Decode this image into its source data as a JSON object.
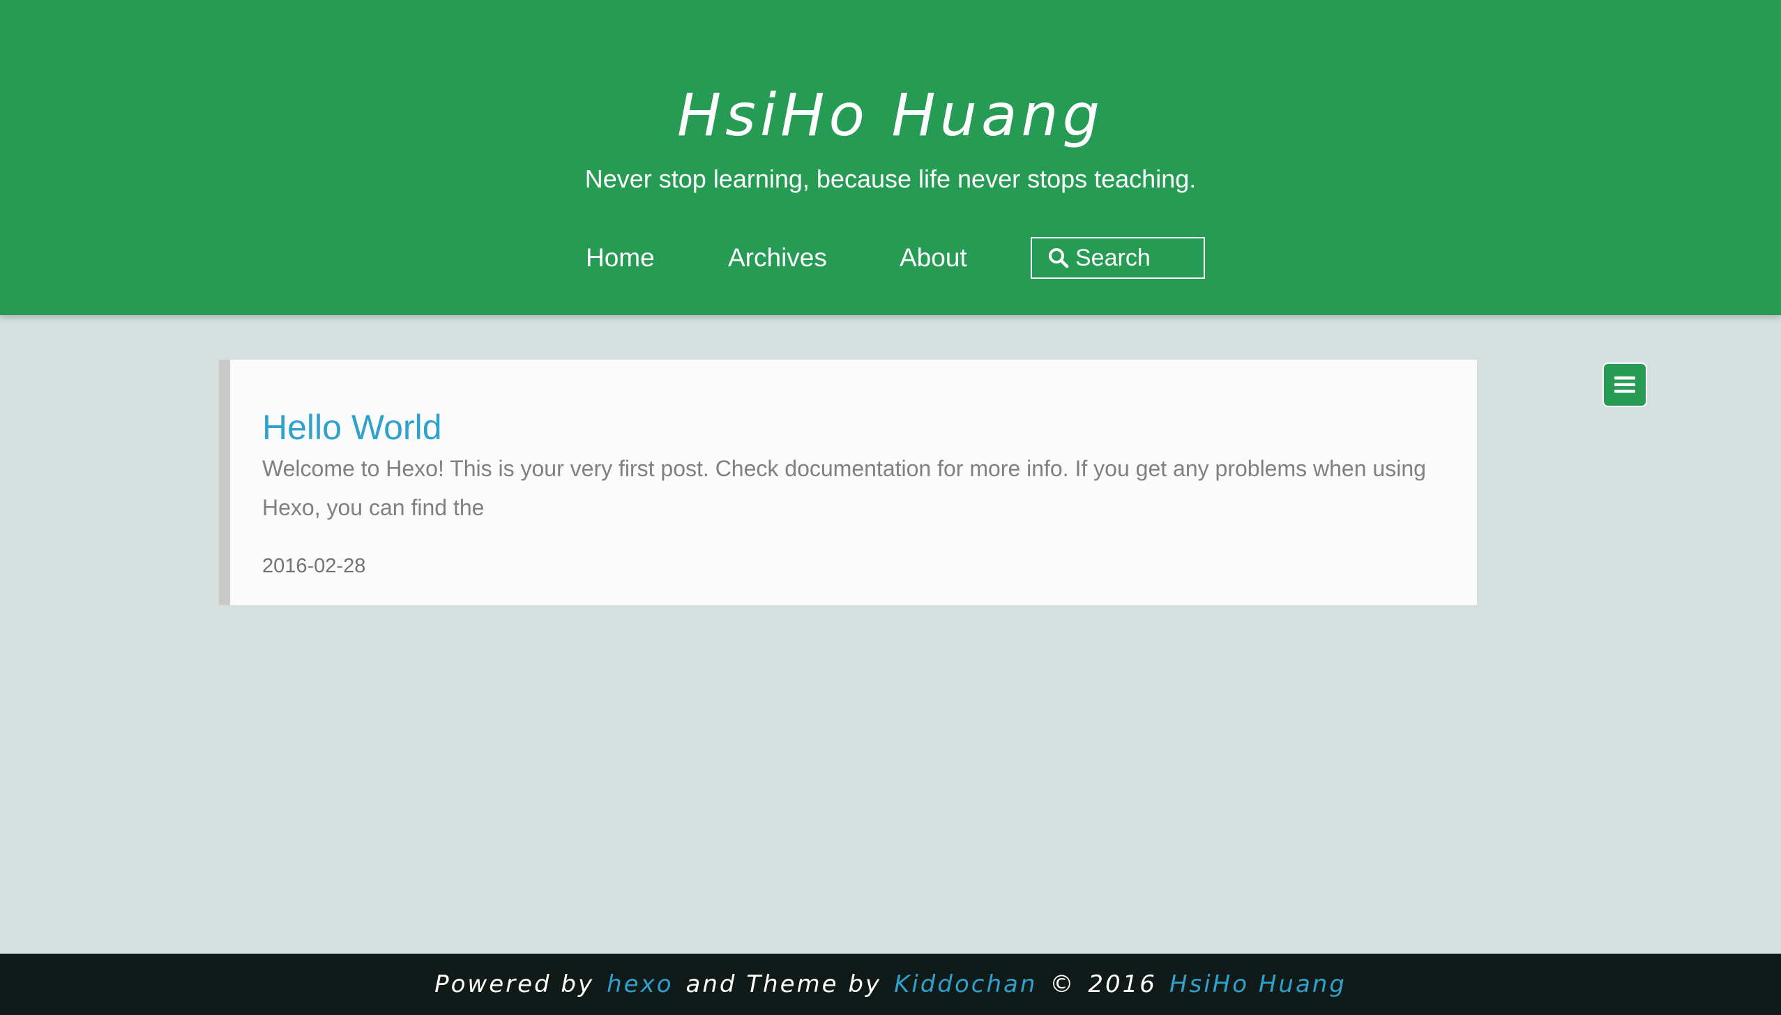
{
  "header": {
    "title": "HsiHo Huang",
    "subtitle": "Never stop learning, because life never stops teaching."
  },
  "nav": {
    "items": [
      {
        "label": "Home"
      },
      {
        "label": "Archives"
      },
      {
        "label": "About"
      }
    ],
    "search": {
      "label": "Search",
      "icon": "search-icon"
    }
  },
  "post": {
    "title": "Hello World",
    "excerpt": "Welcome to Hexo! This is your very first post. Check documentation for more info. If you get any problems when using Hexo, you can find the",
    "date": "2016-02-28"
  },
  "menu_toggle": {
    "icon": "hamburger-menu-icon"
  },
  "footer": {
    "powered_by": "Powered by",
    "hexo": "hexo",
    "and_theme_by": "and Theme by",
    "theme_author": "Kiddochan",
    "copyright": "©",
    "year": "2016",
    "owner": "HsiHo Huang"
  },
  "colors": {
    "header_bg": "#269b53",
    "page_bg": "#d5dfde",
    "link": "#2ea1cc",
    "footer_bg": "#101a18"
  }
}
